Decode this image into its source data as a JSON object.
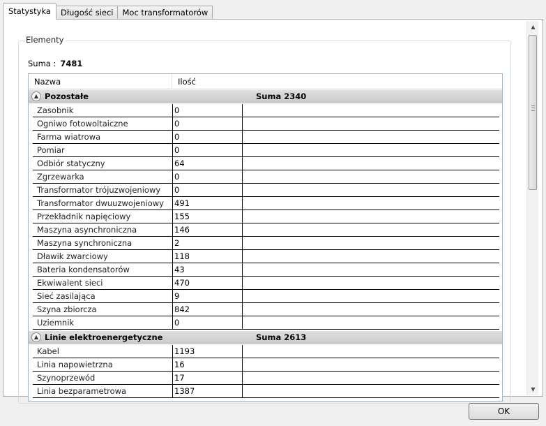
{
  "tabs": [
    {
      "label": "Statystyka",
      "active": true
    },
    {
      "label": "Długość sieci",
      "active": false
    },
    {
      "label": "Moc transformatorów",
      "active": false
    }
  ],
  "groupbox": {
    "title": "Elementy"
  },
  "total": {
    "label": "Suma :",
    "value": "7481"
  },
  "grid": {
    "columns": {
      "name": "Nazwa",
      "qty": "Ilość"
    },
    "groups": [
      {
        "name": "Pozostałe",
        "sum": "Suma 2340",
        "rows": [
          {
            "name": "Zasobnik",
            "qty": "0"
          },
          {
            "name": "Ogniwo fotowoltaiczne",
            "qty": "0"
          },
          {
            "name": "Farma wiatrowa",
            "qty": "0"
          },
          {
            "name": "Pomiar",
            "qty": "0"
          },
          {
            "name": "Odbiór statyczny",
            "qty": "64"
          },
          {
            "name": "Zgrzewarka",
            "qty": "0"
          },
          {
            "name": "Transformator trójuzwojeniowy",
            "qty": "0"
          },
          {
            "name": "Transformator dwuuzwojeniowy",
            "qty": "491"
          },
          {
            "name": "Przekładnik napięciowy",
            "qty": "155"
          },
          {
            "name": "Maszyna asynchroniczna",
            "qty": "146"
          },
          {
            "name": "Maszyna synchroniczna",
            "qty": "2"
          },
          {
            "name": "Dławik zwarciowy",
            "qty": "118"
          },
          {
            "name": "Bateria kondensatorów",
            "qty": "43"
          },
          {
            "name": "Ekwiwalent sieci",
            "qty": "470"
          },
          {
            "name": "Sieć zasilająca",
            "qty": "9"
          },
          {
            "name": "Szyna zbiorcza",
            "qty": "842"
          },
          {
            "name": "Uziemnik",
            "qty": "0"
          }
        ]
      },
      {
        "name": "Linie elektroenergetyczne",
        "sum": "Suma 2613",
        "rows": [
          {
            "name": "Kabel",
            "qty": "1193"
          },
          {
            "name": "Linia napowietrzna",
            "qty": "16"
          },
          {
            "name": "Szynoprzewód",
            "qty": "17"
          },
          {
            "name": "Linia bezparametrowa",
            "qty": "1387"
          }
        ]
      }
    ]
  },
  "ok_label": "OK"
}
